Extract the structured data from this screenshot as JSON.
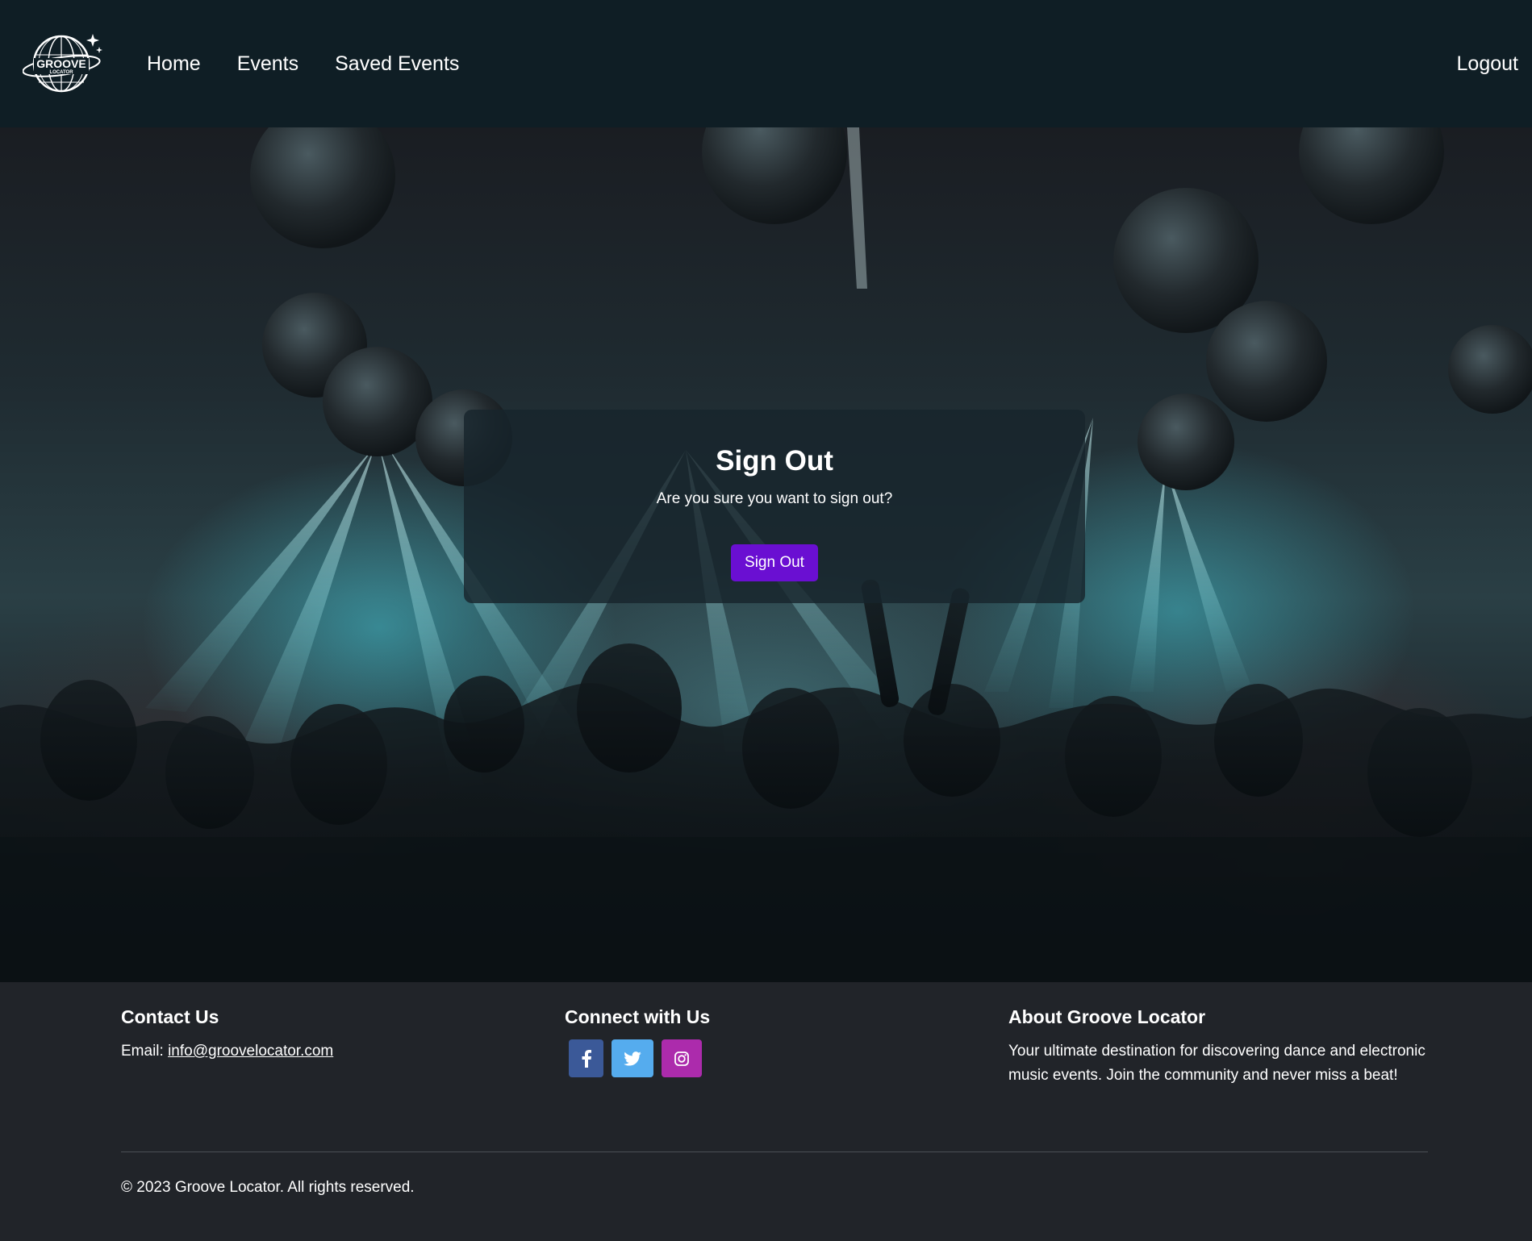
{
  "nav": {
    "logo_icon": "groove-locator-globe-logo",
    "logo_text_main": "GROOVE",
    "logo_text_sub": "LOCATOR",
    "links": [
      {
        "label": "Home"
      },
      {
        "label": "Events"
      },
      {
        "label": "Saved Events"
      }
    ],
    "logout_label": "Logout"
  },
  "hero": {
    "background_icon": "concert-crowd-with-disco-balls-image"
  },
  "signout": {
    "title": "Sign Out",
    "message": "Are you sure you want to sign out?",
    "button_label": "Sign Out",
    "button_color": "#6a0fd2"
  },
  "footer": {
    "contact": {
      "heading": "Contact Us",
      "email_prefix": "Email: ",
      "email": "info@groovelocator.com"
    },
    "connect": {
      "heading": "Connect with Us",
      "social": [
        {
          "icon": "facebook-icon",
          "color": "#3b5998"
        },
        {
          "icon": "twitter-icon",
          "color": "#55acee"
        },
        {
          "icon": "instagram-icon",
          "color": "#ac2bac"
        }
      ]
    },
    "about": {
      "heading": "About Groove Locator",
      "text": "Your ultimate destination for discovering dance and electronic music events. Join the community and never miss a beat!"
    },
    "copyright": "© 2023 Groove Locator. All rights reserved."
  },
  "colors": {
    "navbar_bg": "#0f1e25",
    "footer_bg": "#212429"
  }
}
